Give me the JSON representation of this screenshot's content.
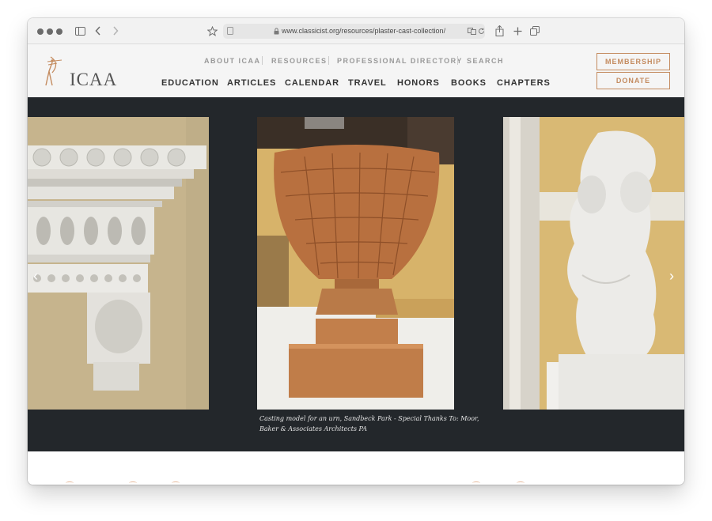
{
  "browser": {
    "url": "www.classicist.org/resources/plaster-cast-collection/"
  },
  "header": {
    "logo_text": "ICAA",
    "utility_nav": [
      "ABOUT ICAA",
      "RESOURCES",
      "PROFESSIONAL DIRECTORY",
      "SEARCH"
    ],
    "main_nav": [
      "EDUCATION",
      "ARTICLES",
      "CALENDAR",
      "TRAVEL",
      "HONORS",
      "BOOKS",
      "CHAPTERS"
    ],
    "membership_label": "MEMBERSHIP",
    "donate_label": "DONATE"
  },
  "carousel": {
    "caption": "Casting model for an urn, Sandbeck Park - Special Thanks To: Moor, Baker & Associates Architects PA",
    "prev_arrow": "‹",
    "next_arrow": "›"
  },
  "colors": {
    "accent": "#c48b5f",
    "carousel_bg": "#23272b",
    "header_bg": "#f5f5f5"
  }
}
